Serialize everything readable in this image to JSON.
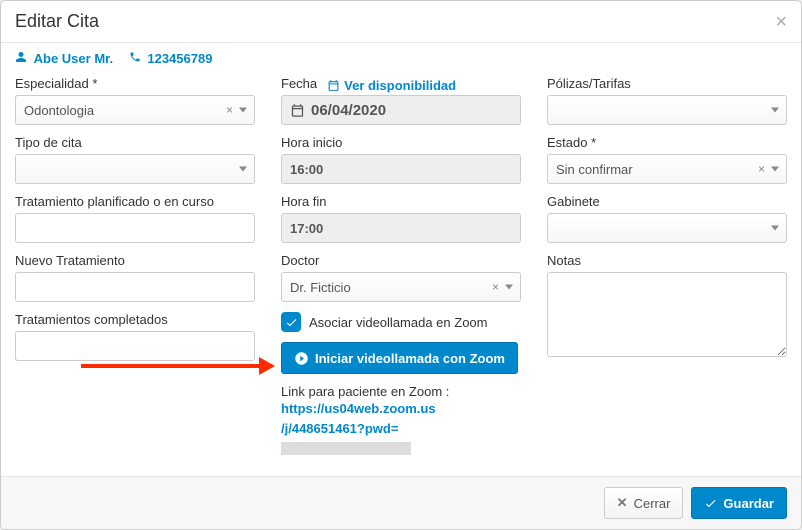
{
  "header": {
    "title": "Editar Cita"
  },
  "patient": {
    "name": "Abe User Mr.",
    "phone": "123456789"
  },
  "left": {
    "especialidad_label": "Especialidad *",
    "especialidad_value": "Odontologia",
    "tipo_label": "Tipo de cita",
    "tipo_value": "",
    "tratamiento_planificado_label": "Tratamiento planificado o en curso",
    "nuevo_tratamiento_label": "Nuevo Tratamiento",
    "tratamientos_completados_label": "Tratamientos completados"
  },
  "mid": {
    "fecha_label": "Fecha",
    "disponibilidad_label": "Ver disponibilidad",
    "fecha_value": "06/04/2020",
    "hora_inicio_label": "Hora inicio",
    "hora_inicio_value": "16:00",
    "hora_fin_label": "Hora fin",
    "hora_fin_value": "17:00",
    "doctor_label": "Doctor",
    "doctor_value": "Dr. Ficticio",
    "zoom_checkbox_label": "Asociar videollamada en Zoom",
    "zoom_button_label": "Iniciar videollamada con Zoom",
    "zoom_link_label": "Link para paciente en Zoom :",
    "zoom_link_line1": "https://us04web.zoom.us",
    "zoom_link_line2": "/j/448651461?pwd="
  },
  "right": {
    "polizas_label": "Pólizas/Tarifas",
    "estado_label": "Estado *",
    "estado_value": "Sin confirmar",
    "gabinete_label": "Gabinete",
    "notas_label": "Notas"
  },
  "footer": {
    "cerrar": "Cerrar",
    "guardar": "Guardar"
  }
}
